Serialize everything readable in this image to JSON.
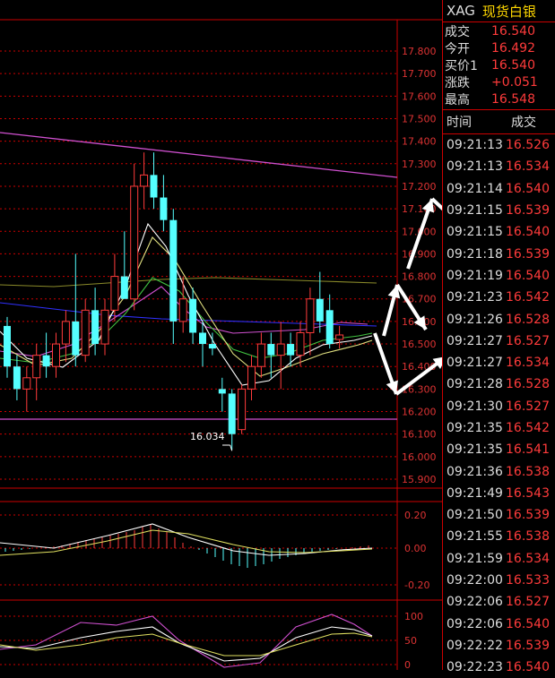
{
  "header": {
    "symbol": "XAG",
    "name": "现货白银"
  },
  "quotes": [
    {
      "label": "成交",
      "value": "16.540"
    },
    {
      "label": "今开",
      "value": "16.492"
    },
    {
      "label": "买价1",
      "value": "16.540"
    },
    {
      "label": "涨跌",
      "value": "+0.051"
    },
    {
      "label": "最高",
      "value": "16.548"
    }
  ],
  "ticks_header": {
    "time": "时间",
    "price": "成交"
  },
  "ticks": [
    {
      "time": "09:21:13",
      "price": "16.526"
    },
    {
      "time": "09:21:13",
      "price": "16.534"
    },
    {
      "time": "09:21:14",
      "price": "16.540"
    },
    {
      "time": "09:21:15",
      "price": "16.539"
    },
    {
      "time": "09:21:15",
      "price": "16.540"
    },
    {
      "time": "09:21:18",
      "price": "16.539"
    },
    {
      "time": "09:21:19",
      "price": "16.540"
    },
    {
      "time": "09:21:23",
      "price": "16.542"
    },
    {
      "time": "09:21:26",
      "price": "16.528"
    },
    {
      "time": "09:21:27",
      "price": "16.527"
    },
    {
      "time": "09:21:27",
      "price": "16.534"
    },
    {
      "time": "09:21:28",
      "price": "16.528"
    },
    {
      "time": "09:21:30",
      "price": "16.527"
    },
    {
      "time": "09:21:35",
      "price": "16.542"
    },
    {
      "time": "09:21:35",
      "price": "16.541"
    },
    {
      "time": "09:21:36",
      "price": "16.538"
    },
    {
      "time": "09:21:49",
      "price": "16.543"
    },
    {
      "time": "09:21:50",
      "price": "16.539"
    },
    {
      "time": "09:21:55",
      "price": "16.538"
    },
    {
      "time": "09:21:59",
      "price": "16.534"
    },
    {
      "time": "09:22:00",
      "price": "16.533"
    },
    {
      "time": "09:22:06",
      "price": "16.527"
    },
    {
      "time": "09:22:06",
      "price": "16.540"
    },
    {
      "time": "09:22:22",
      "price": "16.539"
    },
    {
      "time": "09:22:23",
      "price": "16.540"
    }
  ],
  "chart_data": {
    "type": "candlestick",
    "price_axis": [
      "17.800",
      "17.700",
      "17.600",
      "17.500",
      "17.400",
      "17.300",
      "17.200",
      "17.100",
      "17.000",
      "16.900",
      "16.800",
      "16.700",
      "16.600",
      "16.500",
      "16.400",
      "16.300",
      "16.200",
      "16.100",
      "16.000",
      "15.900"
    ],
    "ylim": [
      15.9,
      17.85
    ],
    "low_annotation": "16.034",
    "candles": [
      {
        "o": 16.58,
        "h": 16.62,
        "l": 16.35,
        "c": 16.4
      },
      {
        "o": 16.4,
        "h": 16.45,
        "l": 16.25,
        "c": 16.3
      },
      {
        "o": 16.3,
        "h": 16.4,
        "l": 16.2,
        "c": 16.35
      },
      {
        "o": 16.35,
        "h": 16.5,
        "l": 16.25,
        "c": 16.45
      },
      {
        "o": 16.45,
        "h": 16.55,
        "l": 16.35,
        "c": 16.4
      },
      {
        "o": 16.4,
        "h": 16.55,
        "l": 16.35,
        "c": 16.5
      },
      {
        "o": 16.5,
        "h": 16.65,
        "l": 16.42,
        "c": 16.6
      },
      {
        "o": 16.6,
        "h": 16.9,
        "l": 16.4,
        "c": 16.45
      },
      {
        "o": 16.45,
        "h": 16.7,
        "l": 16.42,
        "c": 16.65
      },
      {
        "o": 16.65,
        "h": 16.75,
        "l": 16.45,
        "c": 16.5
      },
      {
        "o": 16.5,
        "h": 16.7,
        "l": 16.45,
        "c": 16.65
      },
      {
        "o": 16.65,
        "h": 16.9,
        "l": 16.6,
        "c": 16.8
      },
      {
        "o": 16.8,
        "h": 17.0,
        "l": 16.7,
        "c": 16.7
      },
      {
        "o": 16.7,
        "h": 17.3,
        "l": 16.65,
        "c": 17.2
      },
      {
        "o": 17.2,
        "h": 17.35,
        "l": 17.1,
        "c": 17.25
      },
      {
        "o": 17.25,
        "h": 17.35,
        "l": 17.1,
        "c": 17.15
      },
      {
        "o": 17.15,
        "h": 17.25,
        "l": 17.0,
        "c": 17.05
      },
      {
        "o": 17.05,
        "h": 17.1,
        "l": 16.5,
        "c": 16.6
      },
      {
        "o": 16.6,
        "h": 16.8,
        "l": 16.55,
        "c": 16.7
      },
      {
        "o": 16.7,
        "h": 16.75,
        "l": 16.5,
        "c": 16.55
      },
      {
        "o": 16.55,
        "h": 16.6,
        "l": 16.4,
        "c": 16.5
      },
      {
        "o": 16.5,
        "h": 16.55,
        "l": 16.45,
        "c": 16.48
      },
      {
        "o": 16.3,
        "h": 16.35,
        "l": 16.2,
        "c": 16.28
      },
      {
        "o": 16.28,
        "h": 16.3,
        "l": 16.03,
        "c": 16.1
      },
      {
        "o": 16.12,
        "h": 16.32,
        "l": 16.1,
        "c": 16.3
      },
      {
        "o": 16.3,
        "h": 16.45,
        "l": 16.25,
        "c": 16.4
      },
      {
        "o": 16.4,
        "h": 16.55,
        "l": 16.35,
        "c": 16.5
      },
      {
        "o": 16.5,
        "h": 16.55,
        "l": 16.35,
        "c": 16.45
      },
      {
        "o": 16.45,
        "h": 16.6,
        "l": 16.3,
        "c": 16.5
      },
      {
        "o": 16.5,
        "h": 16.55,
        "l": 16.4,
        "c": 16.45
      },
      {
        "o": 16.45,
        "h": 16.6,
        "l": 16.4,
        "c": 16.55
      },
      {
        "o": 16.55,
        "h": 16.75,
        "l": 16.45,
        "c": 16.7
      },
      {
        "o": 16.7,
        "h": 16.82,
        "l": 16.55,
        "c": 16.6
      },
      {
        "o": 16.65,
        "h": 16.72,
        "l": 16.48,
        "c": 16.5
      },
      {
        "o": 16.52,
        "h": 16.58,
        "l": 16.48,
        "c": 16.54
      }
    ],
    "macd_axis": [
      "0.20",
      "0.00",
      "-0.20"
    ],
    "kdj_axis": [
      "100",
      "50",
      "0"
    ]
  }
}
